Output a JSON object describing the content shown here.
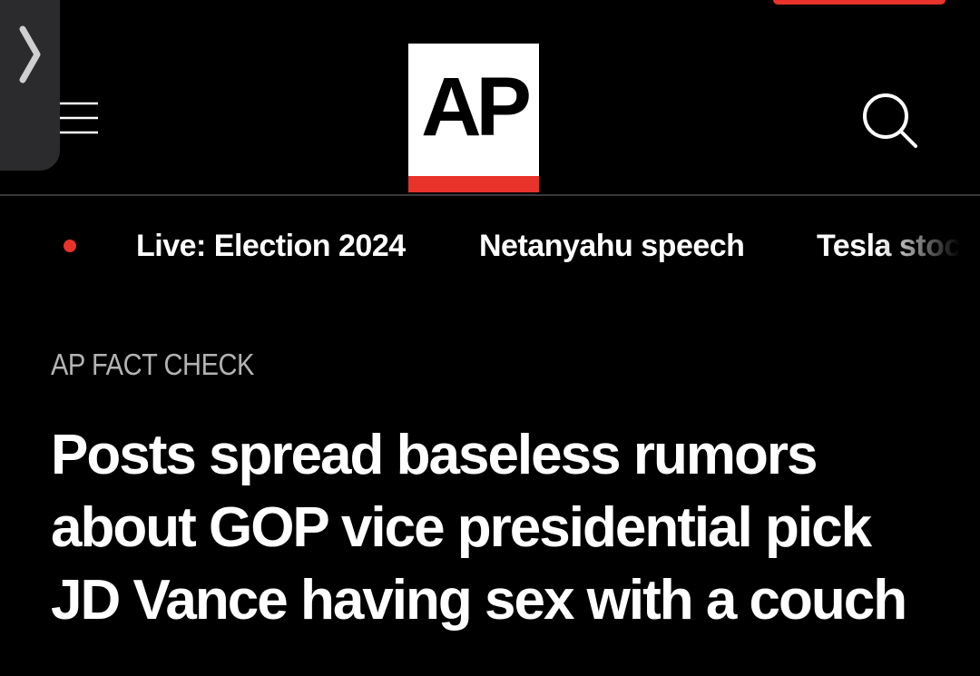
{
  "header": {
    "logo_text": "AP",
    "menu_icon": "hamburger-menu-icon",
    "search_icon": "search-icon",
    "side_tab_icon": "chevron-right-icon"
  },
  "trending": {
    "items": [
      {
        "label": "Live: Election 2024",
        "live": true
      },
      {
        "label": "Netanyahu speech"
      },
      {
        "label": "Tesla stoc"
      }
    ]
  },
  "article": {
    "kicker": "AP FACT CHECK",
    "headline_lines": [
      "Posts spread baseless rumors",
      "about GOP vice presidential pick",
      "JD Vance having sex with a couch"
    ]
  },
  "colors": {
    "background": "#000000",
    "accent_red": "#e8332a",
    "text_primary": "#ffffff",
    "text_secondary": "#b3b3b3",
    "side_tab": "#2b2b2d"
  }
}
